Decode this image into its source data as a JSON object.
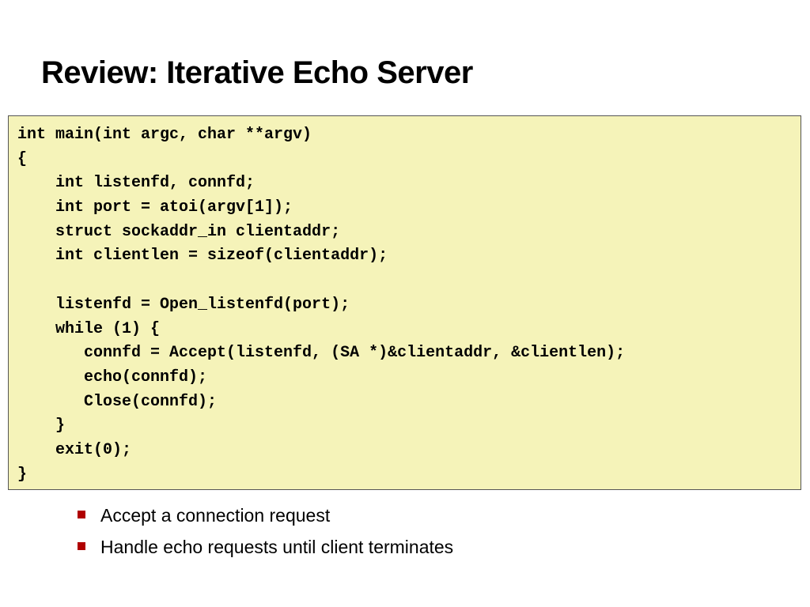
{
  "slide": {
    "title": "Review: Iterative Echo Server",
    "code_lines": [
      "int main(int argc, char **argv)",
      "{",
      "    int listenfd, connfd;",
      "    int port = atoi(argv[1]);",
      "    struct sockaddr_in clientaddr;",
      "    int clientlen = sizeof(clientaddr);",
      "",
      "    listenfd = Open_listenfd(port);",
      "    while (1) {",
      "       connfd = Accept(listenfd, (SA *)&clientaddr, &clientlen);",
      "       echo(connfd);",
      "       Close(connfd);",
      "    }",
      "    exit(0);",
      "}"
    ],
    "bullets": [
      "Accept a connection request",
      "Handle echo requests until client terminates"
    ],
    "colors": {
      "code_background": "#f5f3b9",
      "bullet_marker": "#b00000"
    },
    "icons": {
      "bullet": "red-square-bullet-icon"
    }
  }
}
